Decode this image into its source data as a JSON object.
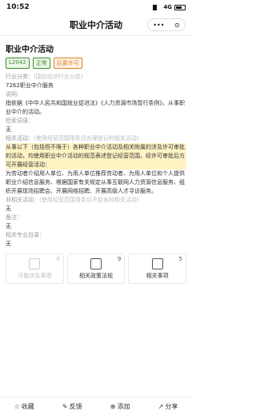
{
  "status": {
    "time": "10:52",
    "network": "4G"
  },
  "nav": {
    "title": "职业中介活动",
    "capsule_more": "•••",
    "capsule_close": "⊙"
  },
  "item": {
    "title": "职业中介活动",
    "tags": [
      "L2042",
      "正常",
      "后置许可"
    ]
  },
  "fields": {
    "industry_label": "行业分类：",
    "industry_hint": "(国民经济行业分类)",
    "industry_value": "7262职业中介服务",
    "basis_label": "说明：",
    "basis_value": "指依据《中华人民共和国就业促进法》《人力资源市场暂行条例》，从事职业中介的活动。",
    "keywords_label": "检索词语：",
    "keywords_value": "无",
    "related_label": "相关活动：",
    "related_hint": "(使用经营范围用条目办理登记的相关活动)",
    "related_value": "从事以下（包括但不限于）各种职业中介活动及相关附属的涉及许可审批的活动，均使用职业中介活动的规范表述登记经营范围。经许可审批后方可开展经营活动：",
    "related_detail": "为劳动者介绍用人单位、为用人单位推荐劳动者、为用人单位和个人提供职业介绍信息服务、根据国家有关规定从事互联网人力资源信息服务、组织开展现场招聘会、开展网络招聘、开展高级人才寻访服务。",
    "nonrelated_label": "非相关活动：",
    "nonrelated_hint": "(使用经营范围用条目不包含的相关活动)",
    "nonrelated_value": "无",
    "remark_label": "备注：",
    "remark_value": "无",
    "catalog_label": "相关专业目录：",
    "catalog_value": "无"
  },
  "cards": [
    {
      "label": "可能涉及事项",
      "count": "0"
    },
    {
      "label": "相关政策法规",
      "count": "9"
    },
    {
      "label": "相关事项",
      "count": "5"
    }
  ],
  "bottom": {
    "collect": "收藏",
    "feedback": "反馈",
    "add": "添加",
    "share": "分享"
  }
}
